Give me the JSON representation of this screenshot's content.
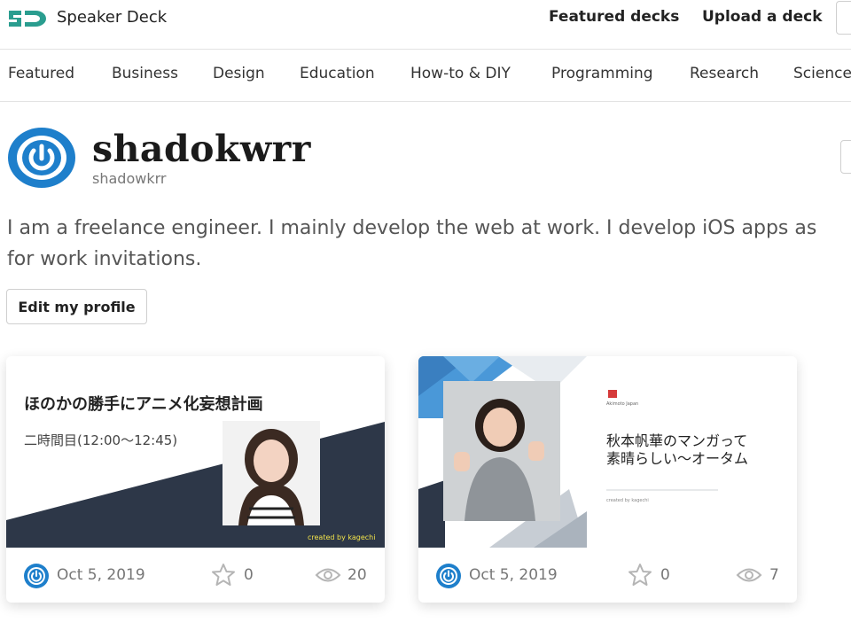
{
  "header": {
    "brand": "Speaker Deck",
    "nav_featured": "Featured decks",
    "nav_upload": "Upload a deck"
  },
  "categories": [
    "Featured",
    "Business",
    "Design",
    "Education",
    "How-to & DIY",
    "Programming",
    "Research",
    "Science"
  ],
  "profile": {
    "name": "shadokwrr",
    "handle": "shadowkrr",
    "bio_line1": "I am a freelance engineer. I mainly develop the web at work. I develop iOS apps as",
    "bio_line2": "for work invitations.",
    "edit_label": "Edit my profile"
  },
  "decks": [
    {
      "slide_title": "ほのかの勝手にアニメ化妄想計画",
      "slide_subtitle": "二時間目(12:00〜12:45)",
      "slide_credit": "created by kagechi",
      "date": "Oct 5, 2019",
      "stars": "0",
      "views": "20"
    },
    {
      "slide_brand": "Akimoto Japan",
      "slide_title_line1": "秋本帆華のマンガって",
      "slide_title_line2": "素晴らしい〜オータム",
      "slide_credit": "created by kagechi",
      "date": "Oct 5, 2019",
      "stars": "0",
      "views": "7"
    }
  ],
  "colors": {
    "brand_teal": "#2a9d8f",
    "avatar_blue": "#1e7fcb",
    "slide_navy": "#2d3748",
    "slide_sky": "#4a98d8",
    "credit_yellow": "#f2e34a"
  },
  "icons": {
    "logo": "speaker-deck-logo",
    "star": "star-icon",
    "views": "eye-icon",
    "avatar": "power-button-avatar"
  }
}
